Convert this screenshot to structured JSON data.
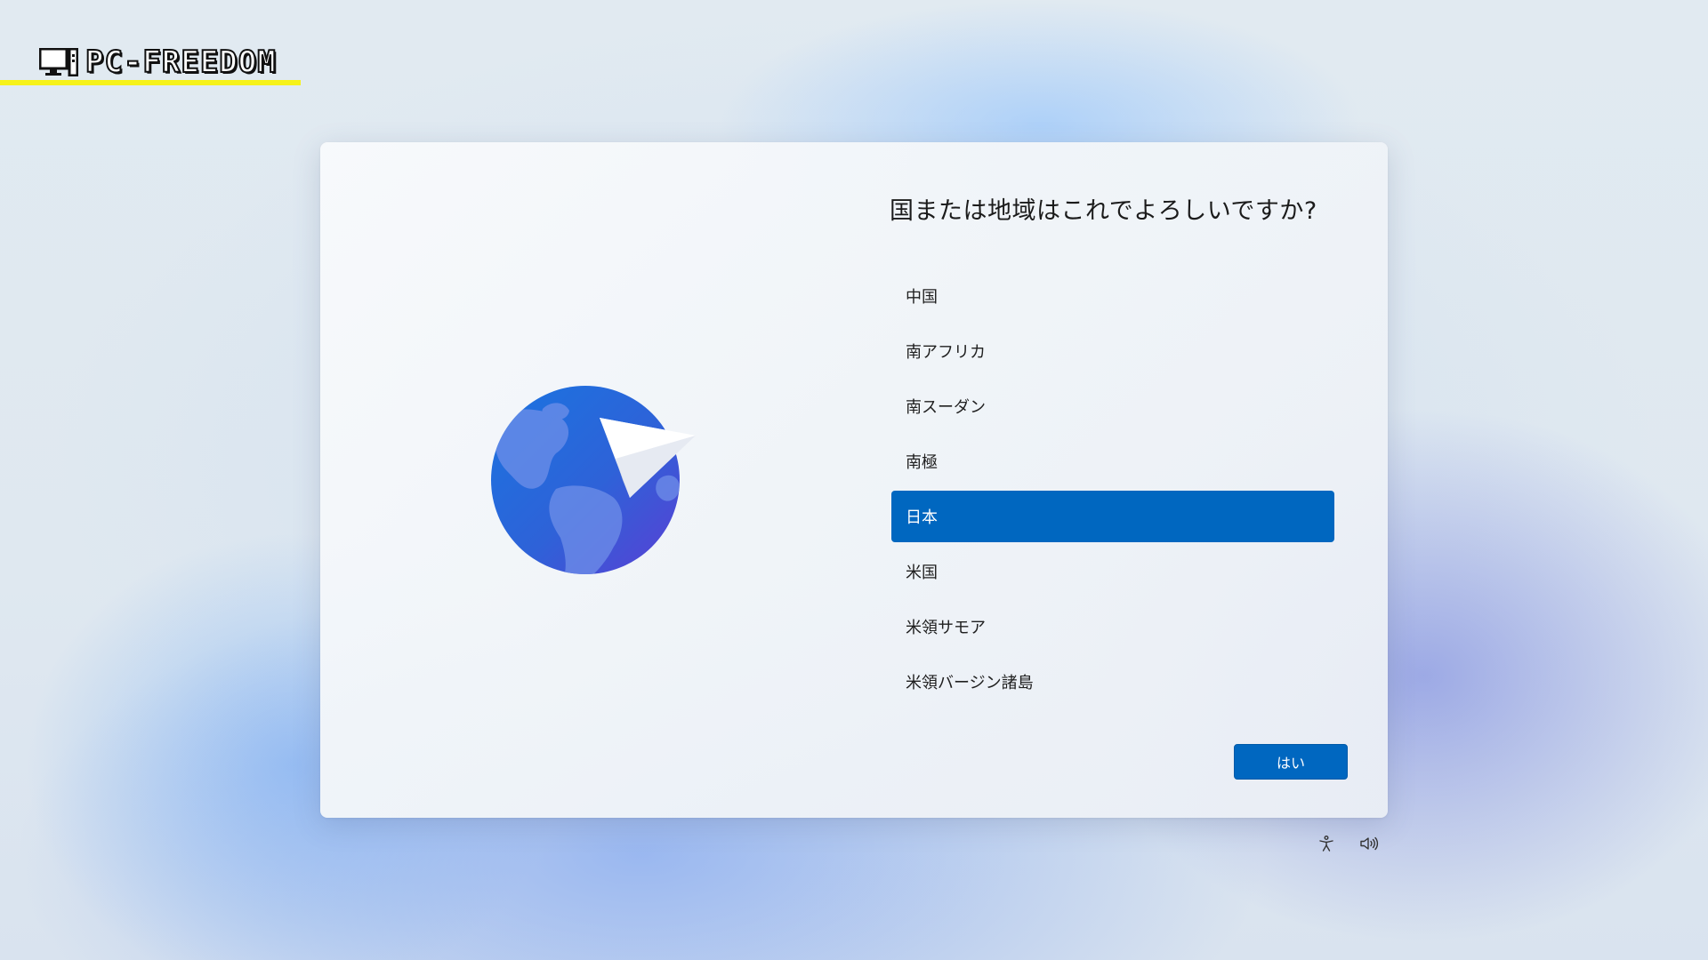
{
  "watermark": {
    "brand": "PC-FREEDOM",
    "icon": "computer-icon",
    "underline_color": "#f6f21a"
  },
  "dialog": {
    "question": "国または地域はこれでよろしいですか?",
    "illustration": "globe-paper-plane-icon",
    "countries": [
      {
        "label": "中国",
        "selected": false
      },
      {
        "label": "南アフリカ",
        "selected": false
      },
      {
        "label": "南スーダン",
        "selected": false
      },
      {
        "label": "南極",
        "selected": false
      },
      {
        "label": "日本",
        "selected": true
      },
      {
        "label": "米国",
        "selected": false
      },
      {
        "label": "米領サモア",
        "selected": false
      },
      {
        "label": "米領バージン諸島",
        "selected": false
      }
    ],
    "confirm_label": "はい",
    "accent_color": "#0067c0"
  },
  "footer": {
    "accessibility_icon": "accessibility-icon",
    "volume_icon": "volume-icon"
  }
}
